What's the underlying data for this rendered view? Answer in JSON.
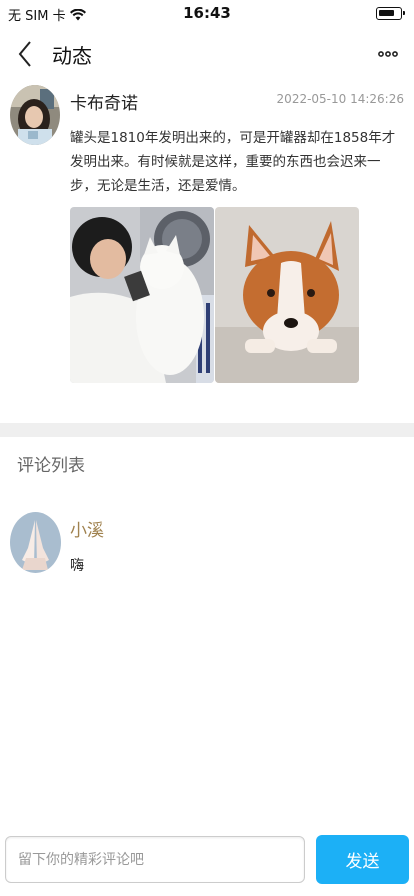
{
  "status_bar": {
    "carrier": "无 SIM 卡",
    "wifi_icon": "wifi-icon",
    "time": "16:43",
    "battery_icon": "battery-icon"
  },
  "nav": {
    "back_icon": "chevron-left-icon",
    "title": "动态",
    "more_icon": "more-dots-icon"
  },
  "post": {
    "author": "卡布奇诺",
    "timestamp": "2022-05-10 14:26:26",
    "text": "罐头是1810年发明出来的，可是开罐器却在1858年才发明出来。有时候就是这样，重要的东西也会迟来一步，无论是生活，还是爱情。",
    "images": [
      "boy-and-white-cat-photo",
      "corgi-dog-photo"
    ]
  },
  "comments": {
    "heading": "评论列表",
    "items": [
      {
        "author": "小溪",
        "text": "嗨",
        "avatar": "praying-hands-avatar"
      }
    ]
  },
  "input_bar": {
    "placeholder": "留下你的精彩评论吧",
    "value": "",
    "send_label": "发送"
  },
  "colors": {
    "accent": "#1cb0f6",
    "comment_author": "#a0824f",
    "divider": "#efefef"
  }
}
